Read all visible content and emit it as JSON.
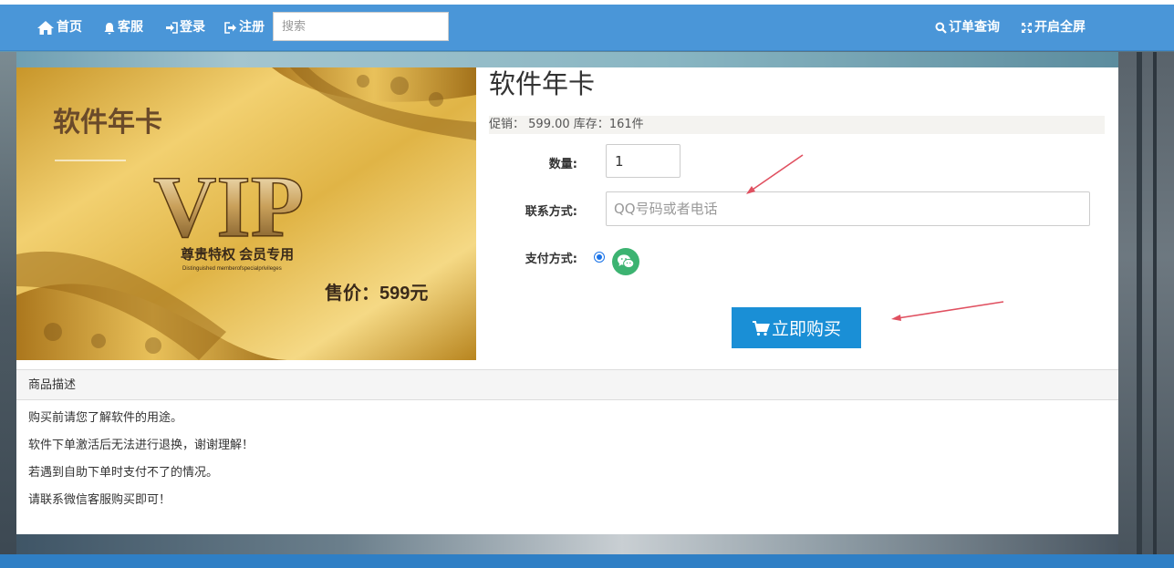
{
  "nav": {
    "home": "首页",
    "service": "客服",
    "login": "登录",
    "register": "注册",
    "search_placeholder": "搜索",
    "order_query": "订单查询",
    "fullscreen": "开启全屏"
  },
  "product": {
    "image_text": {
      "title": "软件年卡",
      "vip": "VIP",
      "slogan": "尊贵特权  会员专用",
      "slogan_en": "Distinguished memberofspecialprivileges",
      "price": "售价：599元"
    },
    "title": "软件年卡",
    "promo_label": "促销：",
    "promo_price": "599.00",
    "stock_label": "库存：",
    "stock_value": "161件"
  },
  "form": {
    "qty_label": "数量:",
    "qty_value": "1",
    "contact_label": "联系方式:",
    "contact_placeholder": "QQ号码或者电话",
    "pay_label": "支付方式:",
    "pay_method_icon": "wechat-icon",
    "buy_label": "立即购买"
  },
  "description": {
    "header": "商品描述",
    "lines": [
      "购买前请您了解软件的用途。",
      "软件下单激活后无法进行退换，谢谢理解！",
      "若遇到自助下单时支付不了的情况。",
      "请联系微信客服购买即可！"
    ]
  },
  "colors": {
    "navbar": "#4a96d8",
    "buy_button": "#1a8fd6",
    "wechat": "#3cb371",
    "arrow": "#e05060"
  }
}
